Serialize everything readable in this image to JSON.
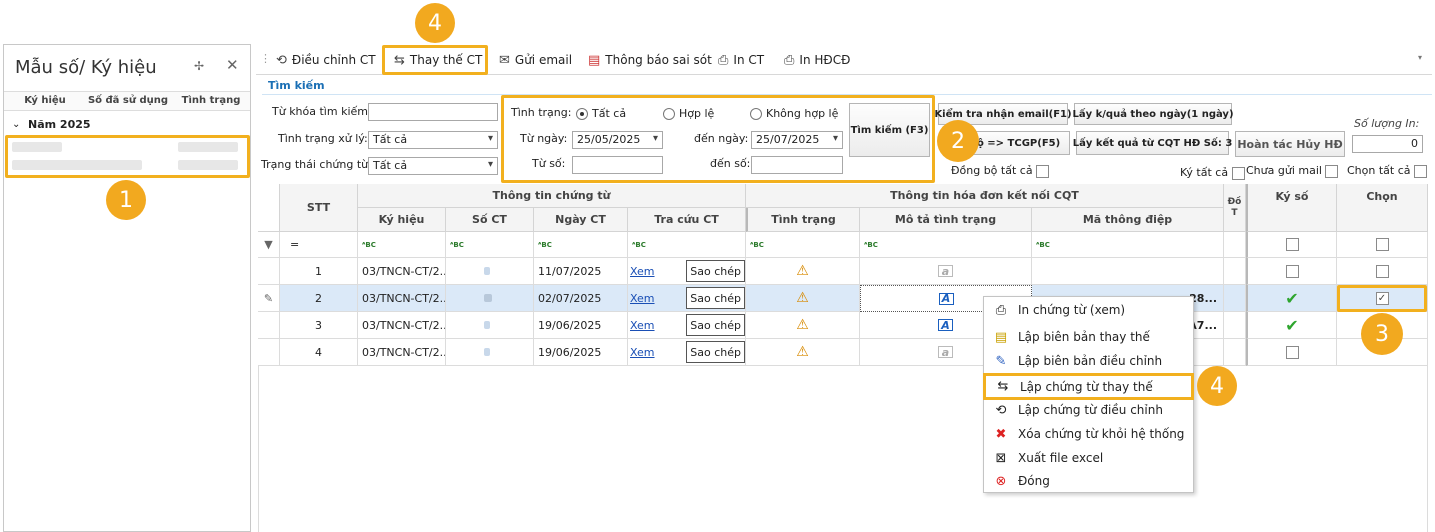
{
  "left_panel": {
    "title": "Mẫu số/ Ký hiệu",
    "columns": [
      "Ký hiệu",
      "Số đã sử dụng",
      "Tình trạng"
    ],
    "year_group": "Năm 2025"
  },
  "toolbar": {
    "items": [
      {
        "label": "Điều chỉnh CT",
        "icon": "adjust-doc-icon"
      },
      {
        "label": "Thay thế CT",
        "icon": "replace-doc-icon"
      },
      {
        "label": "Gửi email",
        "icon": "email-icon"
      },
      {
        "label": "Thông báo sai sót",
        "icon": "report-doc-icon"
      },
      {
        "label": "In CT",
        "icon": "printer-icon"
      },
      {
        "label": "In HĐCĐ",
        "icon": "printer-icon"
      }
    ]
  },
  "search": {
    "tab_label": "Tìm kiếm",
    "keyword_label": "Từ khóa tìm kiếm:",
    "keyword_value": "",
    "status_label": "Tình trạng xử lý:",
    "status_value": "Tất cả",
    "doc_state_label": "Trạng thái chứng từ:",
    "doc_state_value": "Tất cả",
    "condition_label": "Tình trạng:",
    "radio_all": "Tất cả",
    "radio_valid": "Hợp lệ",
    "radio_invalid": "Không hợp lệ",
    "from_date_label": "Từ ngày:",
    "from_date": "25/05/2025",
    "to_date_label": "đến ngày:",
    "to_date": "25/07/2025",
    "from_no_label": "Từ số:",
    "to_no_label": "đến số:",
    "search_button": "Tìm kiếm (F3)",
    "check_email_button": "Kiểm tra nhận email(F1)",
    "get_result_button": "Lấy k/quả theo ngày(1 ngày)",
    "sync_tcgp_button": "bộ => TCGP(F5)",
    "get_cqt_button": "Lấy kết quả từ CQT HĐ Số: 3",
    "undo_cancel_button": "Hoàn tác Hủy HĐ",
    "print_qty_label": "Số lượng In:",
    "print_qty": "0",
    "sync_all_label": "Đồng bộ tất cả",
    "sign_all_label": "Ký tất cả",
    "unsent_mail_label": "Chưa gửi mail",
    "select_all_label": "Chọn tất cả"
  },
  "grid": {
    "group_headers": [
      "Thông tin chứng từ",
      "Thông tin hóa đơn kết nối CQT"
    ],
    "columns": [
      "STT",
      "Ký hiệu",
      "Số CT",
      "Ngày CT",
      "Tra cứu CT",
      "Tình trạng",
      "Mô tả tình trạng",
      "Mã thông điệp",
      "Đồ T",
      "Ký số",
      "Chọn"
    ],
    "rows": [
      {
        "stt": "1",
        "ky_hieu": "03/TNCN-CT/2...",
        "ngay": "11/07/2025",
        "xem": "Xem",
        "sao_chep": "Sao chép",
        "ma": "",
        "signed": false,
        "selected": false
      },
      {
        "stt": "2",
        "ky_hieu": "03/TNCN-CT/2...",
        "ngay": "02/07/2025",
        "xem": "Xem",
        "sao_chep": "Sao chép",
        "ma": "28...",
        "signed": true,
        "selected": true
      },
      {
        "stt": "3",
        "ky_hieu": "03/TNCN-CT/2...",
        "ngay": "19/06/2025",
        "xem": "Xem",
        "sao_chep": "Sao chép",
        "ma": "A7...",
        "signed": true,
        "selected": false
      },
      {
        "stt": "4",
        "ky_hieu": "03/TNCN-CT/2...",
        "ngay": "19/06/2025",
        "xem": "Xem",
        "sao_chep": "Sao chép",
        "ma": "",
        "signed": false,
        "selected": false
      }
    ]
  },
  "context_menu": {
    "items": [
      {
        "label": "In chứng từ (xem)",
        "icon": "printer-icon"
      },
      {
        "label": "Lập biên bản thay thế",
        "icon": "replace-record-icon"
      },
      {
        "label": "Lập biên bản điều chỉnh",
        "icon": "edit-record-icon"
      },
      {
        "label": "Lập chứng từ thay thế",
        "icon": "replace-doc-icon"
      },
      {
        "label": "Lập chứng từ điều chỉnh",
        "icon": "adjust-doc-icon"
      },
      {
        "label": "Xóa chứng từ khỏi hệ thống",
        "icon": "delete-icon"
      },
      {
        "label": "Xuất file excel",
        "icon": "excel-icon"
      },
      {
        "label": "Đóng",
        "icon": "close-circle-icon"
      }
    ]
  },
  "annotations": [
    "1",
    "2",
    "3",
    "4",
    "4"
  ],
  "colors": {
    "highlight": "#f2b01e",
    "badge": "#f2a91f",
    "selected_row": "#dbe9f8",
    "link": "#1a4fb5"
  }
}
